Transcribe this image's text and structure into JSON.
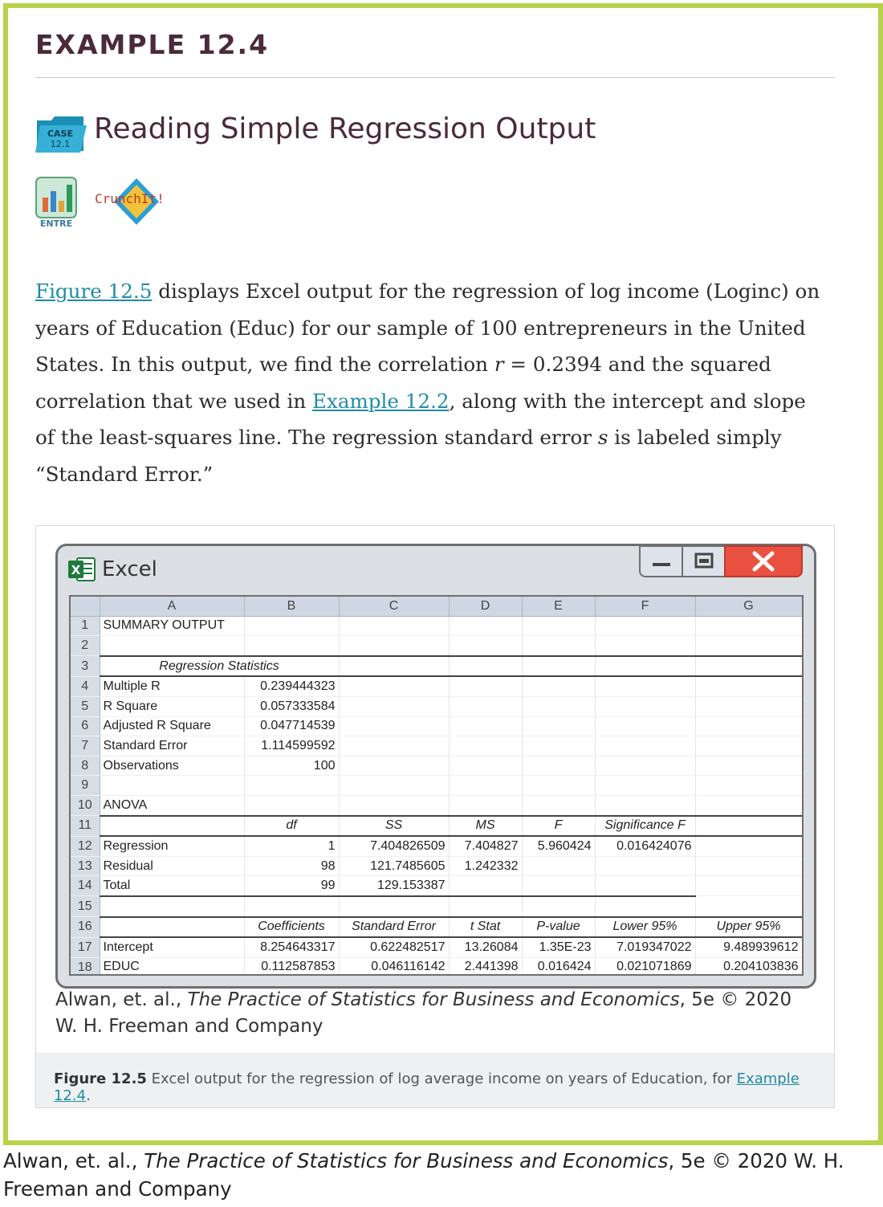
{
  "example": {
    "title": "EXAMPLE 12.4"
  },
  "section": {
    "case_icon_text": "CASE 12.1",
    "title": "Reading Simple Regression Output",
    "entre_label": "ENTRE",
    "crunchit_label": "CrunchIt!"
  },
  "paragraph": {
    "link1": "Figure 12.5",
    "text1": " displays Excel output for the regression of log income (Loginc) on years of Education (Educ) for our sample of 100 entrepreneurs in the United States. In this output, we find the correlation ",
    "r_symbol": "r",
    "text2": " = 0.2394 and the squared correlation that we used in ",
    "link2": "Example 12.2",
    "text3": ", along with the intercept and slope of the least-squares line. The regression standard error ",
    "s_symbol": "s",
    "text4": " is labeled simply “Standard Error.”"
  },
  "excel": {
    "window_title": "Excel",
    "buttons": {
      "minimize": "—",
      "maximize": "▣",
      "close": "✕"
    },
    "columns": [
      "",
      "A",
      "B",
      "C",
      "D",
      "E",
      "F",
      "G"
    ],
    "rows": [
      [
        "1",
        "SUMMARY OUTPUT",
        "",
        "",
        "",
        "",
        "",
        ""
      ],
      [
        "2",
        "",
        "",
        "",
        "",
        "",
        "",
        ""
      ],
      [
        "3",
        "Regression Statistics",
        "",
        "",
        "",
        "",
        "",
        ""
      ],
      [
        "4",
        "Multiple R",
        "0.239444323",
        "",
        "",
        "",
        "",
        ""
      ],
      [
        "5",
        "R Square",
        "0.057333584",
        "",
        "",
        "",
        "",
        ""
      ],
      [
        "6",
        "Adjusted R Square",
        "0.047714539",
        "",
        "",
        "",
        "",
        ""
      ],
      [
        "7",
        "Standard Error",
        "1.114599592",
        "",
        "",
        "",
        "",
        ""
      ],
      [
        "8",
        "Observations",
        "100",
        "",
        "",
        "",
        "",
        ""
      ],
      [
        "9",
        "",
        "",
        "",
        "",
        "",
        "",
        ""
      ],
      [
        "10",
        "ANOVA",
        "",
        "",
        "",
        "",
        "",
        ""
      ],
      [
        "11",
        "",
        "df",
        "SS",
        "MS",
        "F",
        "Significance F",
        ""
      ],
      [
        "12",
        "Regression",
        "1",
        "7.404826509",
        "7.404827",
        "5.960424",
        "0.016424076",
        ""
      ],
      [
        "13",
        "Residual",
        "98",
        "121.7485605",
        "1.242332",
        "",
        "",
        ""
      ],
      [
        "14",
        "Total",
        "99",
        "129.153387",
        "",
        "",
        "",
        ""
      ],
      [
        "15",
        "",
        "",
        "",
        "",
        "",
        "",
        ""
      ],
      [
        "16",
        "",
        "Coefficients",
        "Standard Error",
        "t Stat",
        "P-value",
        "Lower 95%",
        "Upper 95%"
      ],
      [
        "17",
        "Intercept",
        "8.254643317",
        "0.622482517",
        "13.26084",
        "1.35E-23",
        "7.019347022",
        "9.489939612"
      ],
      [
        "18",
        "EDUC",
        "0.112587853",
        "0.046116142",
        "2.441398",
        "0.016424",
        "0.021071869",
        "0.204103836"
      ]
    ]
  },
  "figure_credit": {
    "prefix": "Alwan, et. al., ",
    "book": "The Practice of Statistics for Business and Economics",
    "suffix": ", 5e © 2020 W. H. Freeman and Company"
  },
  "caption": {
    "label": "Figure 12.5",
    "text": " Excel output for the regression of log average income on years of Education, for ",
    "link": "Example 12.4",
    "end": "."
  },
  "page_credit": {
    "prefix": "Alwan, et. al., ",
    "book": "The Practice of Statistics for Business and Economics",
    "suffix": ", 5e © 2020 W. H. Freeman and Company"
  },
  "colors": {
    "frame": "#b7d34b",
    "heading": "#4b2a3a",
    "link": "#1f8ba8",
    "excel_green": "#1e7a3c",
    "close_red": "#e9503f"
  }
}
